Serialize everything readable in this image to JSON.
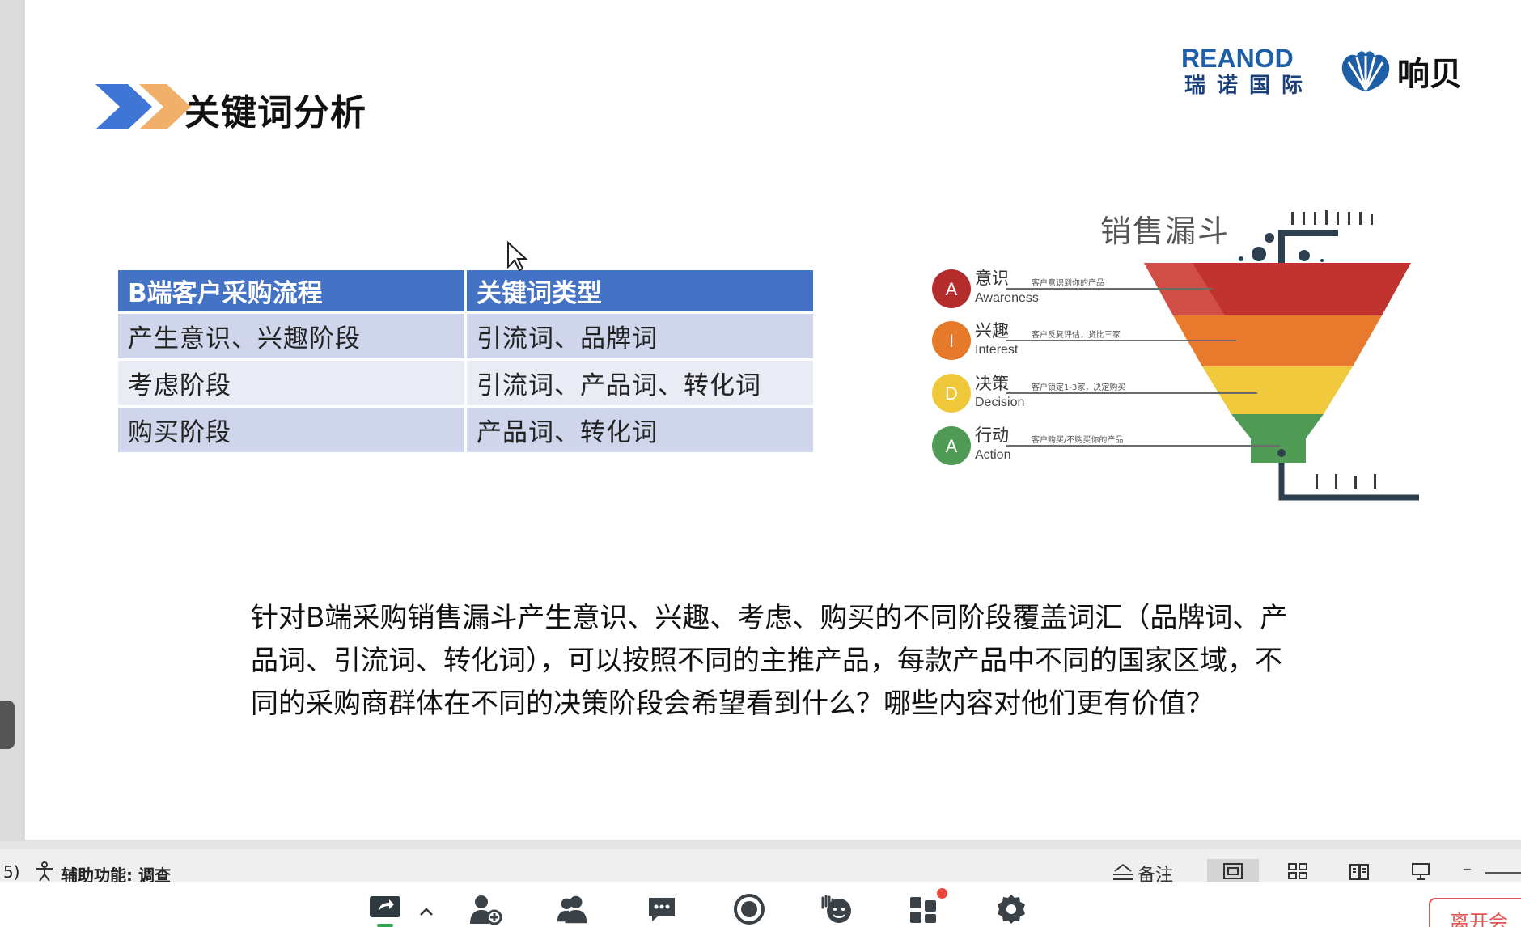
{
  "slide": {
    "title": "关键词分析",
    "logo_reanod_brand": "REANOD",
    "logo_reanod_cn": "瑞诺国际",
    "logo_xiangbei_name": "响贝",
    "table": {
      "headers": [
        "B端客户采购流程",
        "关键词类型"
      ],
      "rows": [
        [
          "产生意识、兴趣阶段",
          "引流词、品牌词"
        ],
        [
          "考虑阶段",
          "引流词、产品词、转化词"
        ],
        [
          "购买阶段",
          "产品词、转化词"
        ]
      ]
    },
    "funnel": {
      "title": "销售漏斗",
      "stages": [
        {
          "letter": "A",
          "cn": "意识",
          "en": "Awareness",
          "note": "客户意识到你的产品",
          "color": "#b52c2c"
        },
        {
          "letter": "I",
          "cn": "兴趣",
          "en": "Interest",
          "note": "客户反复评估，货比三家",
          "color": "#e6792a"
        },
        {
          "letter": "D",
          "cn": "决策",
          "en": "Decision",
          "note": "客户锁定1-3家，决定购买",
          "color": "#efc83a"
        },
        {
          "letter": "A",
          "cn": "行动",
          "en": "Action",
          "note": "客户购买/不购买你的产品",
          "color": "#4f9a55"
        }
      ]
    },
    "body_text": "针对B端采购销售漏斗产生意识、兴趣、考虑、购买的不同阶段覆盖词汇（品牌词、产品词、引流词、转化词），可以按照不同的主推产品，每款产品中不同的国家区域，不同的采购商群体在不同的决策阶段会希望看到什么？哪些内容对他们更有价值？"
  },
  "statusbar": {
    "left_fragment": "5)",
    "accessibility_label": "辅助功能: 调查",
    "notes_label": "备注"
  },
  "toolbar": {
    "leave_label": "离开会"
  },
  "colors": {
    "table_header": "#4472c4",
    "table_row_odd": "#cfd5ea",
    "table_row_even": "#e9ebf5",
    "accent_green": "#2ea44f",
    "alert_red": "#e45353"
  }
}
